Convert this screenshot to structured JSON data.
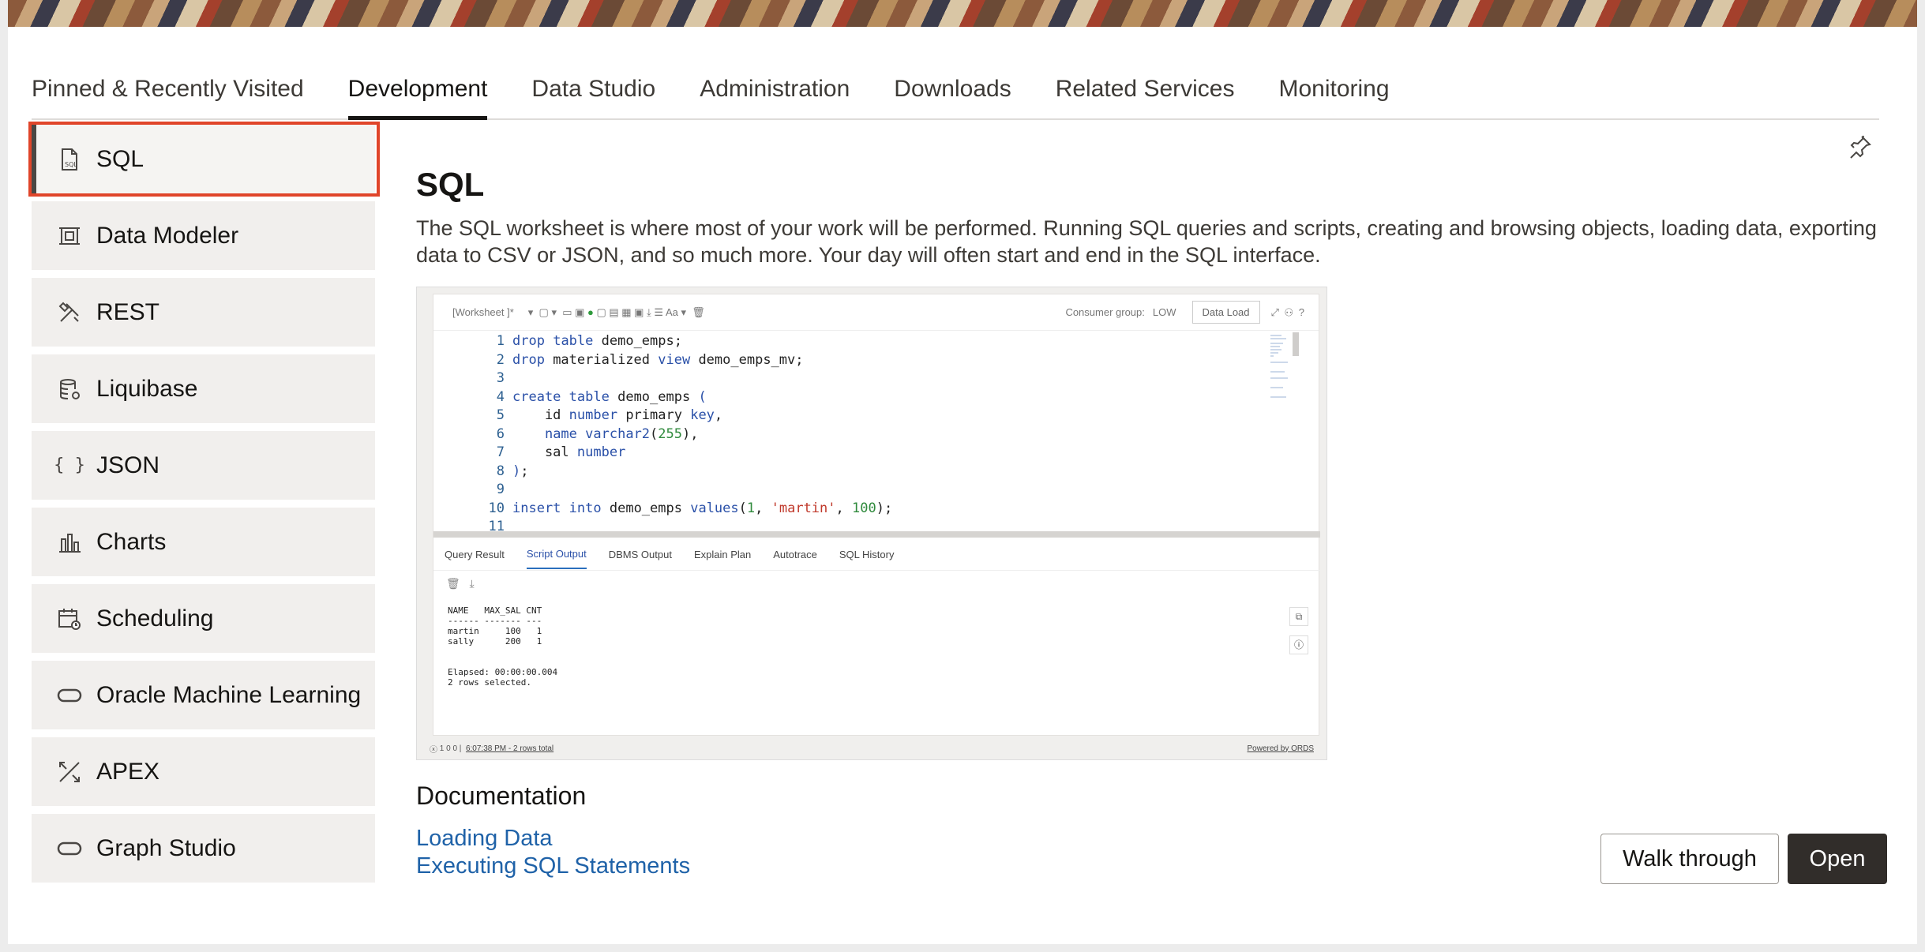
{
  "tabs": [
    {
      "label": "Pinned & Recently Visited"
    },
    {
      "label": "Development"
    },
    {
      "label": "Data Studio"
    },
    {
      "label": "Administration"
    },
    {
      "label": "Downloads"
    },
    {
      "label": "Related Services"
    },
    {
      "label": "Monitoring"
    }
  ],
  "active_tab": "Development",
  "sidebar": {
    "items": [
      {
        "label": "SQL",
        "icon": "sql-file-icon"
      },
      {
        "label": "Data Modeler",
        "icon": "data-modeler-icon"
      },
      {
        "label": "REST",
        "icon": "tools-icon"
      },
      {
        "label": "Liquibase",
        "icon": "database-icon"
      },
      {
        "label": "JSON",
        "icon": "braces-icon"
      },
      {
        "label": "Charts",
        "icon": "bar-chart-icon"
      },
      {
        "label": "Scheduling",
        "icon": "calendar-clock-icon"
      },
      {
        "label": "Oracle Machine Learning",
        "icon": "oracle-oval-icon"
      },
      {
        "label": "APEX",
        "icon": "apex-icon"
      },
      {
        "label": "Graph Studio",
        "icon": "oracle-oval-icon"
      }
    ]
  },
  "main": {
    "title": "SQL",
    "description": "The SQL worksheet is where most of your work will be performed. Running SQL queries and scripts, creating and browsing objects, loading data, exporting data to CSV or JSON, and so much more. Your day will often start and end in the SQL interface.",
    "documentation_heading": "Documentation",
    "links": [
      "Loading Data",
      "Executing SQL Statements"
    ],
    "walk_through_label": "Walk through",
    "open_label": "Open"
  },
  "preview": {
    "worksheet_label": "[Worksheet ]*",
    "consumer_group_label": "Consumer group:",
    "consumer_group_value": "LOW",
    "data_load_label": "Data Load",
    "output_tabs": [
      "Query Result",
      "Script Output",
      "DBMS Output",
      "Explain Plan",
      "Autotrace",
      "SQL History"
    ],
    "active_output_tab": "Script Output",
    "output_text": "NAME   MAX_SAL CNT\n------ ------- ---\nmartin     100   1\nsally      200   1\n\n\nElapsed: 00:00:00.004\n2 rows selected.",
    "status_counts": "1   0   0  |",
    "status_time": "6:07:38 PM - 2 rows total",
    "powered_by": "Powered by ORDS"
  },
  "colors": {
    "highlight": "#e0452a",
    "link": "#1f62a8",
    "open_button": "#312d2a"
  }
}
